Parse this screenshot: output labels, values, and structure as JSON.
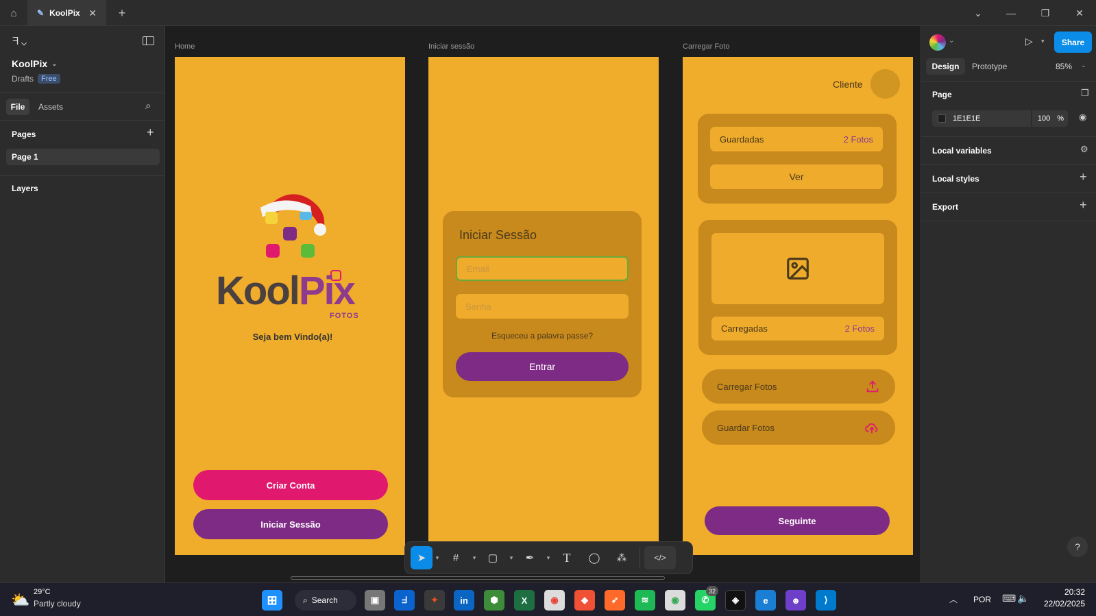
{
  "titlebar": {
    "tab_title": "KoolPix",
    "close": "✕",
    "add": "+"
  },
  "left_panel": {
    "file_name": "KoolPix",
    "location": "Drafts",
    "plan": "Free",
    "tabs": [
      "File",
      "Assets"
    ],
    "pages_title": "Pages",
    "pages": [
      "Page 1"
    ],
    "layers_title": "Layers"
  },
  "frames": {
    "home": {
      "label": "Home",
      "logo_text_koo": "Koo",
      "logo_text_l": "l",
      "logo_text_pix": "Pix",
      "logo_sub": "FOTOS",
      "welcome": "Seja bem Vindo(a)!",
      "create_account": "Criar Conta",
      "login": "Iniciar Sessão"
    },
    "login": {
      "label": "Iniciar sessão",
      "title": "Iniciar Sessão",
      "email_placeholder": "Email",
      "password_placeholder": "Senha",
      "forgot": "Esqueceu a palavra passe?",
      "enter": "Entrar"
    },
    "upload": {
      "label": "Carregar Foto",
      "client": "Cliente",
      "saved": "Guardadas",
      "saved_count": "2 Fotos",
      "view": "Ver",
      "uploaded": "Carregadas",
      "uploaded_count": "2 Fotos",
      "upload_photos": "Carregar Fotos",
      "save_photos": "Guardar Fotos",
      "next": "Seguinte"
    }
  },
  "right_panel": {
    "tabs": [
      "Design",
      "Prototype"
    ],
    "zoom": "85%",
    "share": "Share",
    "page_title": "Page",
    "page_color": "1E1E1E",
    "opacity": "100",
    "opacity_unit": "%",
    "local_variables": "Local variables",
    "local_styles": "Local styles",
    "export": "Export"
  },
  "taskbar": {
    "temperature": "29°C",
    "weather": "Partly cloudy",
    "search": "Search",
    "whatsapp_badge": "32",
    "language": "POR",
    "time": "20:32",
    "date": "22/02/2025"
  },
  "colors": {
    "frame_bg": "#f0ac2b",
    "card_bg": "#c8891d",
    "pink": "#e0196f",
    "purple": "#7e2b85",
    "share_blue": "#0c8ce9"
  }
}
